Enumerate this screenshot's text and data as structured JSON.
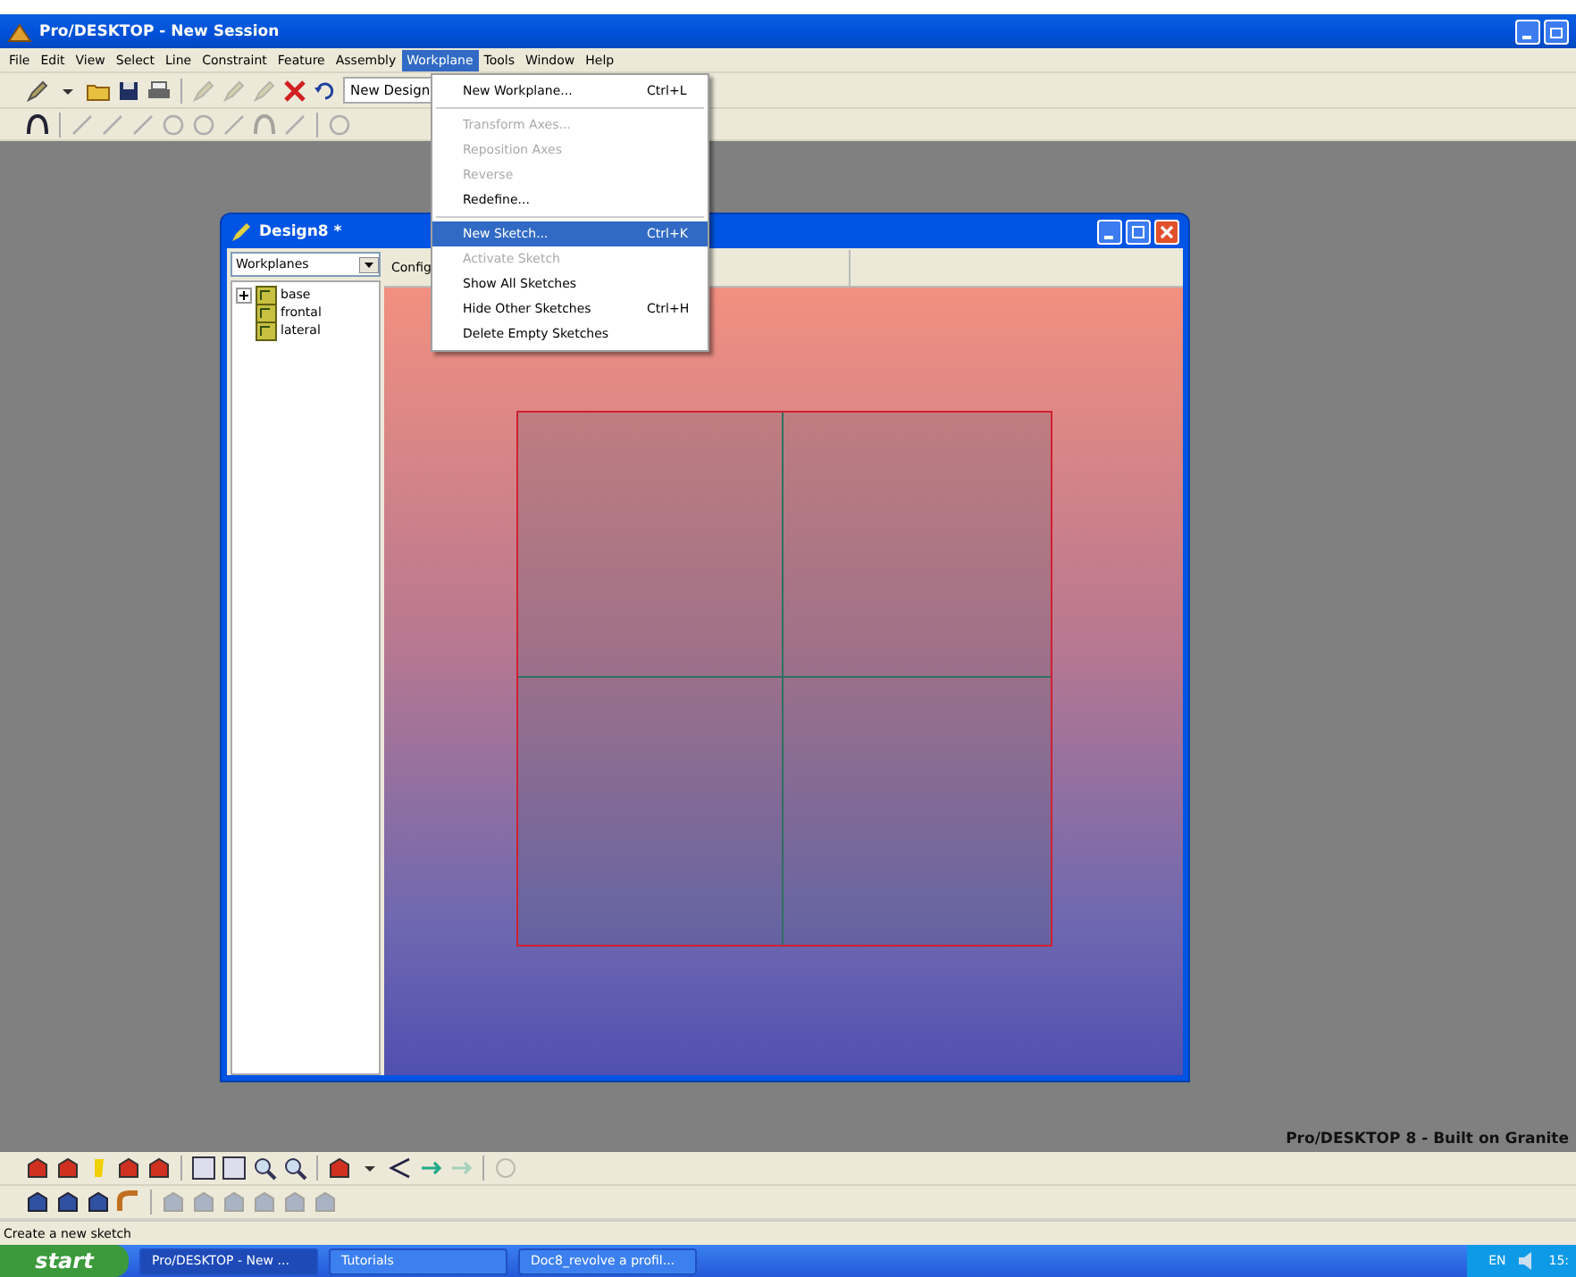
{
  "window": {
    "title": "Pro/DESKTOP - New Session"
  },
  "menubar": [
    {
      "label": "File",
      "selected": false
    },
    {
      "label": "Edit",
      "selected": false
    },
    {
      "label": "View",
      "selected": false
    },
    {
      "label": "Select",
      "selected": false
    },
    {
      "label": "Line",
      "selected": false
    },
    {
      "label": "Constraint",
      "selected": false
    },
    {
      "label": "Feature",
      "selected": false
    },
    {
      "label": "Assembly",
      "selected": false
    },
    {
      "label": "Workplane",
      "selected": true
    },
    {
      "label": "Tools",
      "selected": false
    },
    {
      "label": "Window",
      "selected": false
    },
    {
      "label": "Help",
      "selected": false
    }
  ],
  "toolbar": {
    "design_button": "New Design"
  },
  "workplane_menu": [
    {
      "kind": "item",
      "label": "New Workplane...",
      "shortcut": "Ctrl+L",
      "disabled": false,
      "selected": false
    },
    {
      "kind": "separator"
    },
    {
      "kind": "item",
      "label": "Transform Axes...",
      "disabled": true,
      "selected": false
    },
    {
      "kind": "item",
      "label": "Reposition Axes",
      "disabled": true,
      "selected": false
    },
    {
      "kind": "item",
      "label": "Reverse",
      "disabled": true,
      "selected": false
    },
    {
      "kind": "item",
      "label": "Redefine...",
      "disabled": false,
      "selected": false
    },
    {
      "kind": "separator"
    },
    {
      "kind": "item",
      "label": "New Sketch...",
      "shortcut": "Ctrl+K",
      "disabled": false,
      "selected": true
    },
    {
      "kind": "item",
      "label": "Activate Sketch",
      "disabled": true,
      "selected": false
    },
    {
      "kind": "item",
      "label": "Show All Sketches",
      "disabled": false,
      "selected": false
    },
    {
      "kind": "item",
      "label": "Hide Other Sketches",
      "shortcut": "Ctrl+H",
      "disabled": false,
      "selected": false
    },
    {
      "kind": "item",
      "label": "Delete Empty Sketches",
      "disabled": false,
      "selected": false
    }
  ],
  "design_window": {
    "title": "Design8 *",
    "browser_dropdown": "Workplanes",
    "header_tab": "Config",
    "tree": [
      {
        "label": "base",
        "expanded": false
      },
      {
        "label": "frontal"
      },
      {
        "label": "lateral"
      }
    ]
  },
  "workspace_brand": "Pro/DESKTOP 8 - Built on Granite",
  "status_bar": "Create a new sketch",
  "taskbar": {
    "start": "start",
    "tasks": [
      {
        "label": "Pro/DESKTOP - New ...",
        "selected": true
      },
      {
        "label": "Tutorials",
        "selected": false
      },
      {
        "label": "Doc8_revolve a profil...",
        "selected": false
      }
    ],
    "language": "EN",
    "clock": "15:"
  }
}
